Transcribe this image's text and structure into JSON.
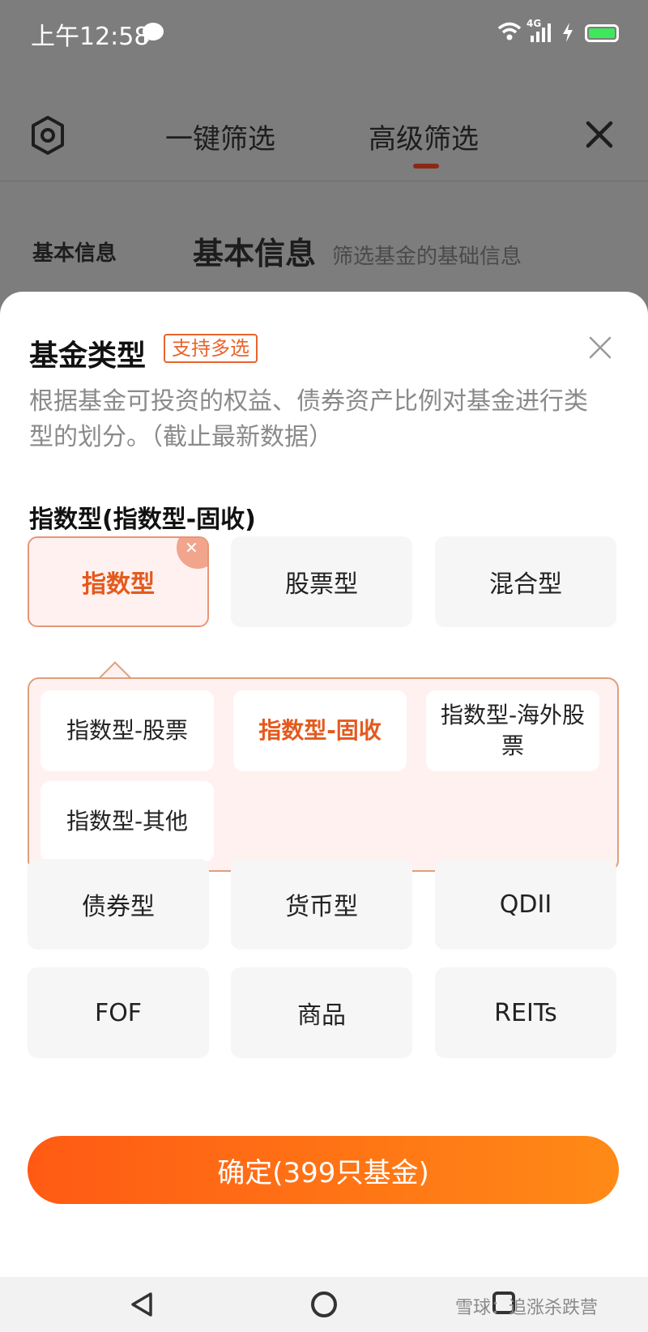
{
  "status_bar": {
    "time": "上午12:58",
    "network": "4G"
  },
  "header": {
    "tabs": [
      {
        "label": "一键筛选"
      },
      {
        "label": "高级筛选"
      }
    ]
  },
  "section": {
    "side_label": "基本信息",
    "title": "基本信息",
    "subtitle": "筛选基金的基础信息"
  },
  "sheet": {
    "title": "基金类型",
    "badge": "支持多选",
    "description": "根据基金可投资的权益、债券资产比例对基金进行类型的划分。（截止最新数据）",
    "group_title": "指数型(指数型-固收)",
    "chips_row1": [
      {
        "label": "指数型",
        "selected": true
      },
      {
        "label": "股票型",
        "selected": false
      },
      {
        "label": "混合型",
        "selected": false
      }
    ],
    "sub_options": [
      {
        "label": "指数型-股票",
        "selected": false
      },
      {
        "label": "指数型-固收",
        "selected": true
      },
      {
        "label": "指数型-海外股票",
        "selected": false
      },
      {
        "label": "指数型-其他",
        "selected": false
      }
    ],
    "chips_row2": [
      {
        "label": "债券型"
      },
      {
        "label": "货币型"
      },
      {
        "label": "QDII"
      }
    ],
    "chips_row3": [
      {
        "label": "FOF"
      },
      {
        "label": "商品"
      },
      {
        "label": "REITs"
      }
    ],
    "confirm_label": "确定(399只基金)"
  },
  "watermark": "雪球：追涨杀跌营",
  "colors": {
    "accent": "#e35a1e",
    "button_start": "#ff5a14",
    "button_end": "#ff8a16"
  }
}
